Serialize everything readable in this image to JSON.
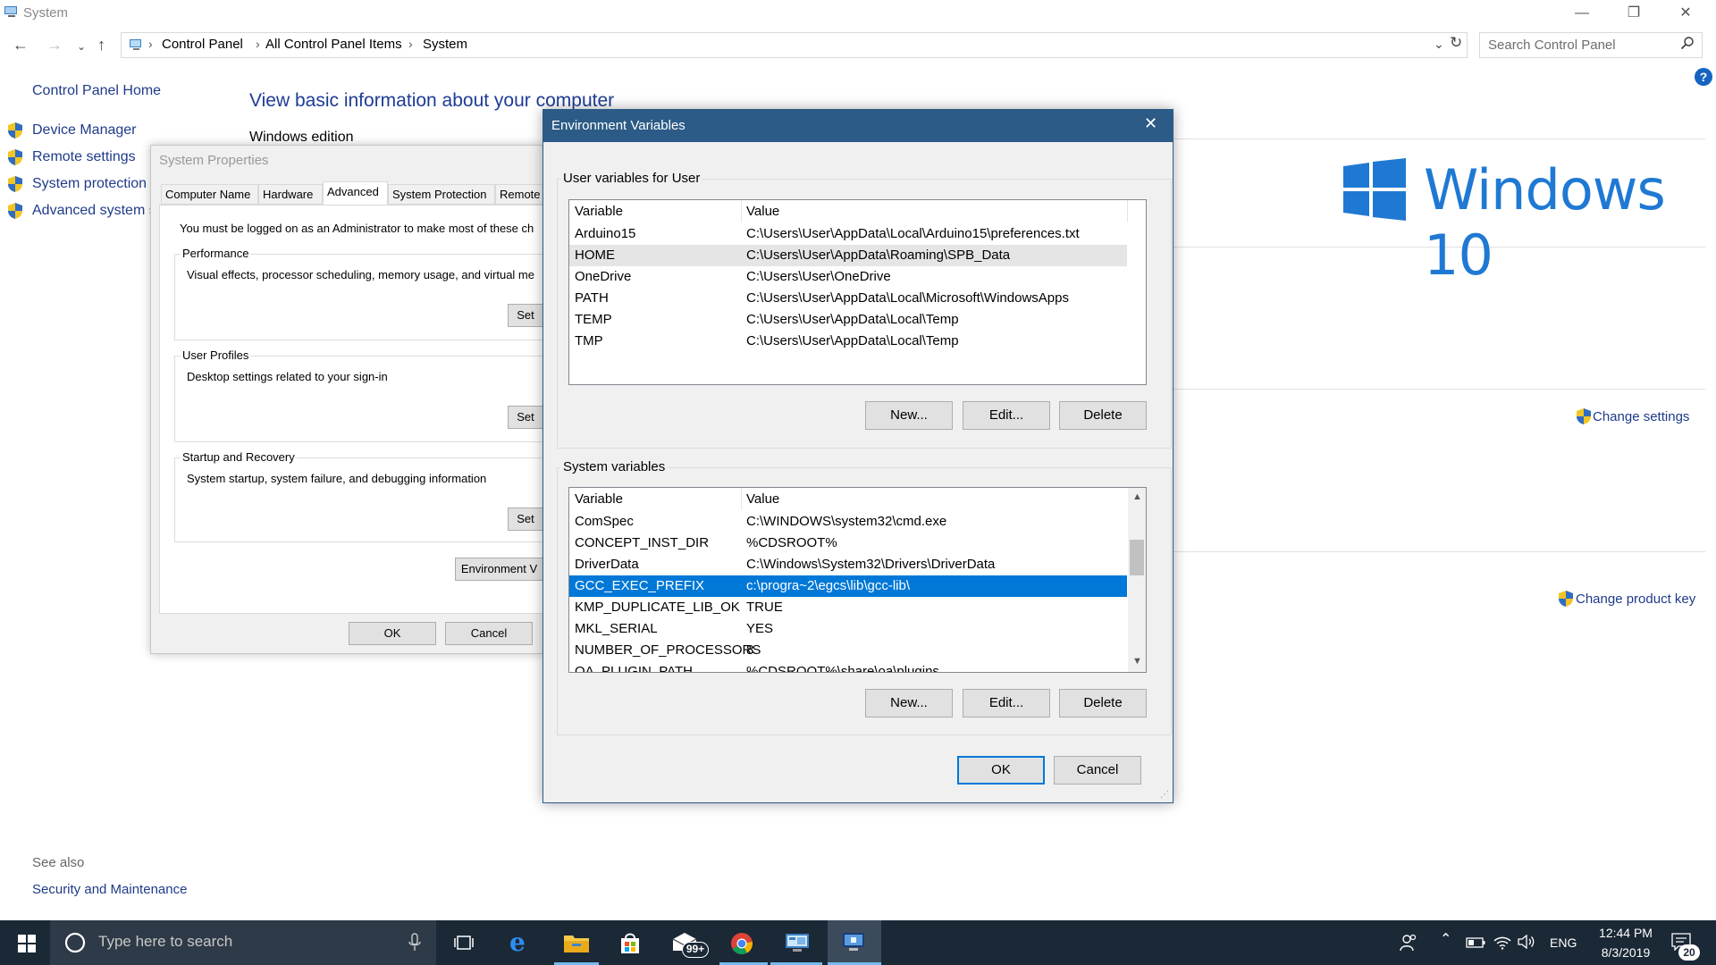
{
  "window": {
    "title": "System",
    "minimize_glyph": "—",
    "restore_glyph": "❐",
    "close_glyph": "✕"
  },
  "address_bar": {
    "breadcrumbs": [
      "Control Panel",
      "All Control Panel Items",
      "System"
    ],
    "search_placeholder": "Search Control Panel"
  },
  "sidebar": {
    "home": "Control Panel Home",
    "items": [
      {
        "label": "Device Manager",
        "icon": "shield-icon"
      },
      {
        "label": "Remote settings",
        "icon": "shield-icon"
      },
      {
        "label": "System protection",
        "icon": "shield-icon"
      },
      {
        "label": "Advanced system se",
        "icon": "shield-icon"
      }
    ],
    "see_also": "See also",
    "see_also_items": [
      "Security and Maintenance"
    ]
  },
  "main": {
    "heading": "View basic information about your computer",
    "windows_edition": "Windows edition",
    "brand_text": "Windows 10",
    "change_settings": "Change settings",
    "change_product_key": "Change product key",
    "help_glyph": "?"
  },
  "system_properties": {
    "title": "System Properties",
    "tabs": [
      "Computer Name",
      "Hardware",
      "Advanced",
      "System Protection",
      "Remote"
    ],
    "active_tab": "Advanced",
    "admin_note": "You must be logged on as an Administrator to make most of these ch",
    "groups": [
      {
        "label": "Performance",
        "desc": "Visual effects, processor scheduling, memory usage, and virtual me",
        "button": "Set"
      },
      {
        "label": "User Profiles",
        "desc": "Desktop settings related to your sign-in",
        "button": "Set"
      },
      {
        "label": "Startup and Recovery",
        "desc": "System startup, system failure, and debugging information",
        "button": "Set"
      }
    ],
    "env_button": "Environment V",
    "ok": "OK",
    "cancel": "Cancel"
  },
  "env_vars": {
    "title": "Environment Variables",
    "close_glyph": "✕",
    "user_group_label": "User variables for User",
    "system_group_label": "System variables",
    "columns": [
      "Variable",
      "Value"
    ],
    "user_rows": [
      [
        "Arduino15",
        "C:\\Users\\User\\AppData\\Local\\Arduino15\\preferences.txt"
      ],
      [
        "HOME",
        "C:\\Users\\User\\AppData\\Roaming\\SPB_Data"
      ],
      [
        "OneDrive",
        "C:\\Users\\User\\OneDrive"
      ],
      [
        "PATH",
        "C:\\Users\\User\\AppData\\Local\\Microsoft\\WindowsApps"
      ],
      [
        "TEMP",
        "C:\\Users\\User\\AppData\\Local\\Temp"
      ],
      [
        "TMP",
        "C:\\Users\\User\\AppData\\Local\\Temp"
      ]
    ],
    "system_rows": [
      [
        "ComSpec",
        "C:\\WINDOWS\\system32\\cmd.exe"
      ],
      [
        "CONCEPT_INST_DIR",
        "%CDSROOT%"
      ],
      [
        "DriverData",
        "C:\\Windows\\System32\\Drivers\\DriverData"
      ],
      [
        "GCC_EXEC_PREFIX",
        "c:\\progra~2\\egcs\\lib\\gcc-lib\\"
      ],
      [
        "KMP_DUPLICATE_LIB_OK",
        "TRUE"
      ],
      [
        "MKL_SERIAL",
        "YES"
      ],
      [
        "NUMBER_OF_PROCESSORS",
        "8"
      ],
      [
        "OA_PLUGIN_PATH",
        "%CDSROOT%\\share\\oa\\plugins"
      ]
    ],
    "hover_user_row": "HOME",
    "selected_system_row": "GCC_EXEC_PREFIX",
    "btn_new": "New...",
    "btn_edit": "Edit...",
    "btn_delete": "Delete",
    "ok": "OK",
    "cancel": "Cancel"
  },
  "taskbar": {
    "search_placeholder": "Type here to search",
    "mail_badge": "99+",
    "language": "ENG",
    "time": "12:44 PM",
    "date": "8/3/2019",
    "notification_count": "20",
    "accent": "#76b9ed"
  }
}
